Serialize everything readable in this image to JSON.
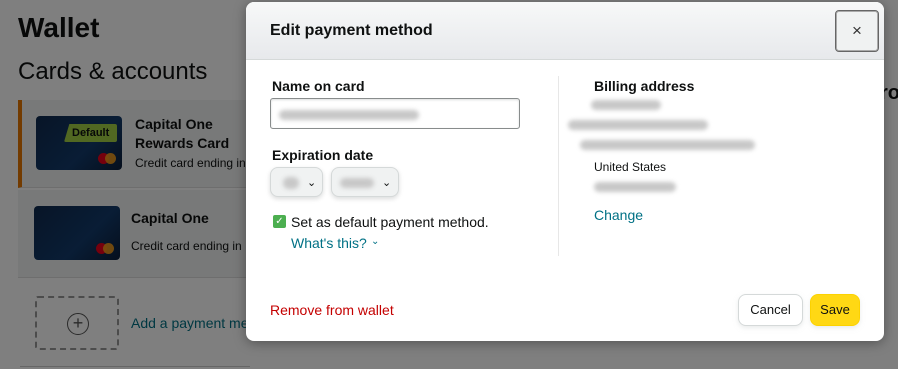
{
  "background": {
    "page_title": "Wallet",
    "section_title": "Cards & accounts",
    "cards": [
      {
        "name": "Capital One",
        "name_line2": "Rewards Card",
        "detail": "Credit card ending in",
        "badge": "Default"
      },
      {
        "name": "Capital One",
        "detail": "Credit card ending in"
      }
    ],
    "add_payment_text": "Add a payment me",
    "right_partial_text": "ro"
  },
  "modal": {
    "title": "Edit payment method",
    "close_symbol": "×",
    "name_label": "Name on card",
    "expiration_label": "Expiration date",
    "default_checked": true,
    "default_label": "Set as default payment method.",
    "whats_this": "What's this?",
    "billing_label": "Billing address",
    "billing_country": "United States",
    "change_link": "Change",
    "remove_link": "Remove from wallet",
    "cancel_label": "Cancel",
    "save_label": "Save"
  },
  "icons": {
    "close": "close-icon",
    "chevron": "chevron-down-icon",
    "check": "checkmark-icon",
    "plus": "plus-icon"
  },
  "colors": {
    "link": "#007185",
    "danger": "#c40000",
    "save": "#ffd814",
    "default_badge": "#a3d044",
    "accent_border": "#e77600"
  }
}
